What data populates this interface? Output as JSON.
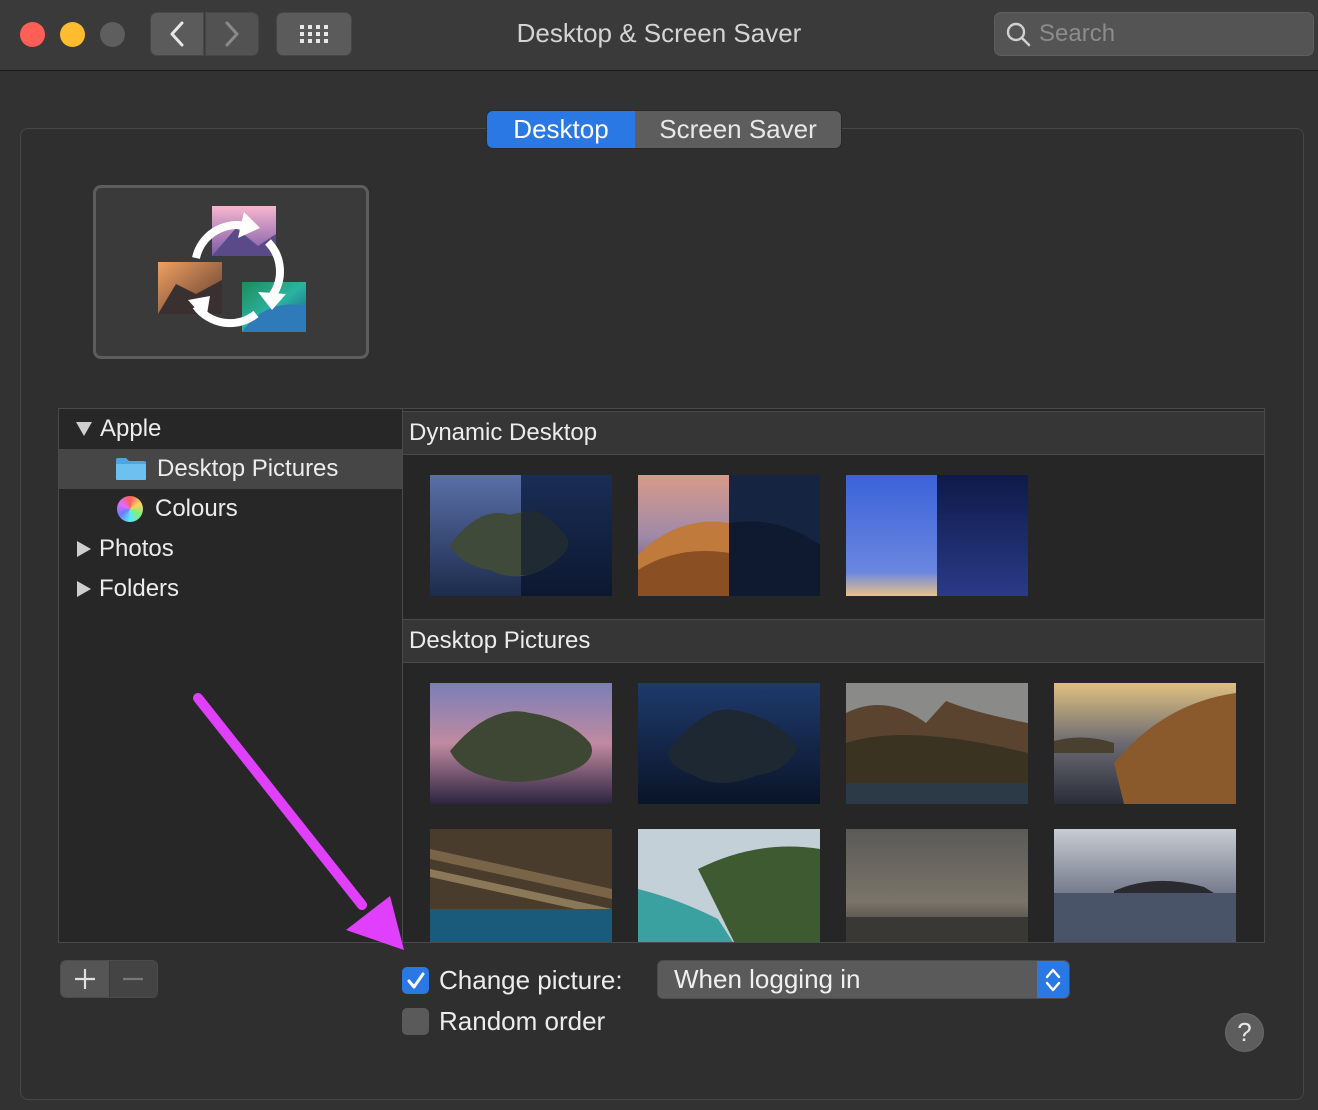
{
  "window": {
    "title": "Desktop & Screen Saver",
    "search_placeholder": "Search"
  },
  "tabs": [
    {
      "label": "Desktop",
      "selected": true
    },
    {
      "label": "Screen Saver",
      "selected": false
    }
  ],
  "sidebar": {
    "items": [
      {
        "label": "Apple",
        "expanded": true,
        "icon": "disclosure-down-icon"
      },
      {
        "label": "Desktop Pictures",
        "selected": true,
        "icon": "folder-icon"
      },
      {
        "label": "Colours",
        "icon": "colour-wheel-icon"
      },
      {
        "label": "Photos",
        "expanded": false,
        "icon": "disclosure-right-icon"
      },
      {
        "label": "Folders",
        "expanded": false,
        "icon": "disclosure-right-icon"
      }
    ]
  },
  "browser": {
    "sections": [
      {
        "title": "Dynamic Desktop"
      },
      {
        "title": "Desktop Pictures"
      }
    ]
  },
  "controls": {
    "change_picture": {
      "label": "Change picture:",
      "checked": true
    },
    "random_order": {
      "label": "Random order",
      "checked": false
    },
    "interval": {
      "selected": "When logging in"
    },
    "help": "?"
  },
  "colors": {
    "accent": "#2a78e4",
    "annotation_arrow": "#e040fb"
  }
}
